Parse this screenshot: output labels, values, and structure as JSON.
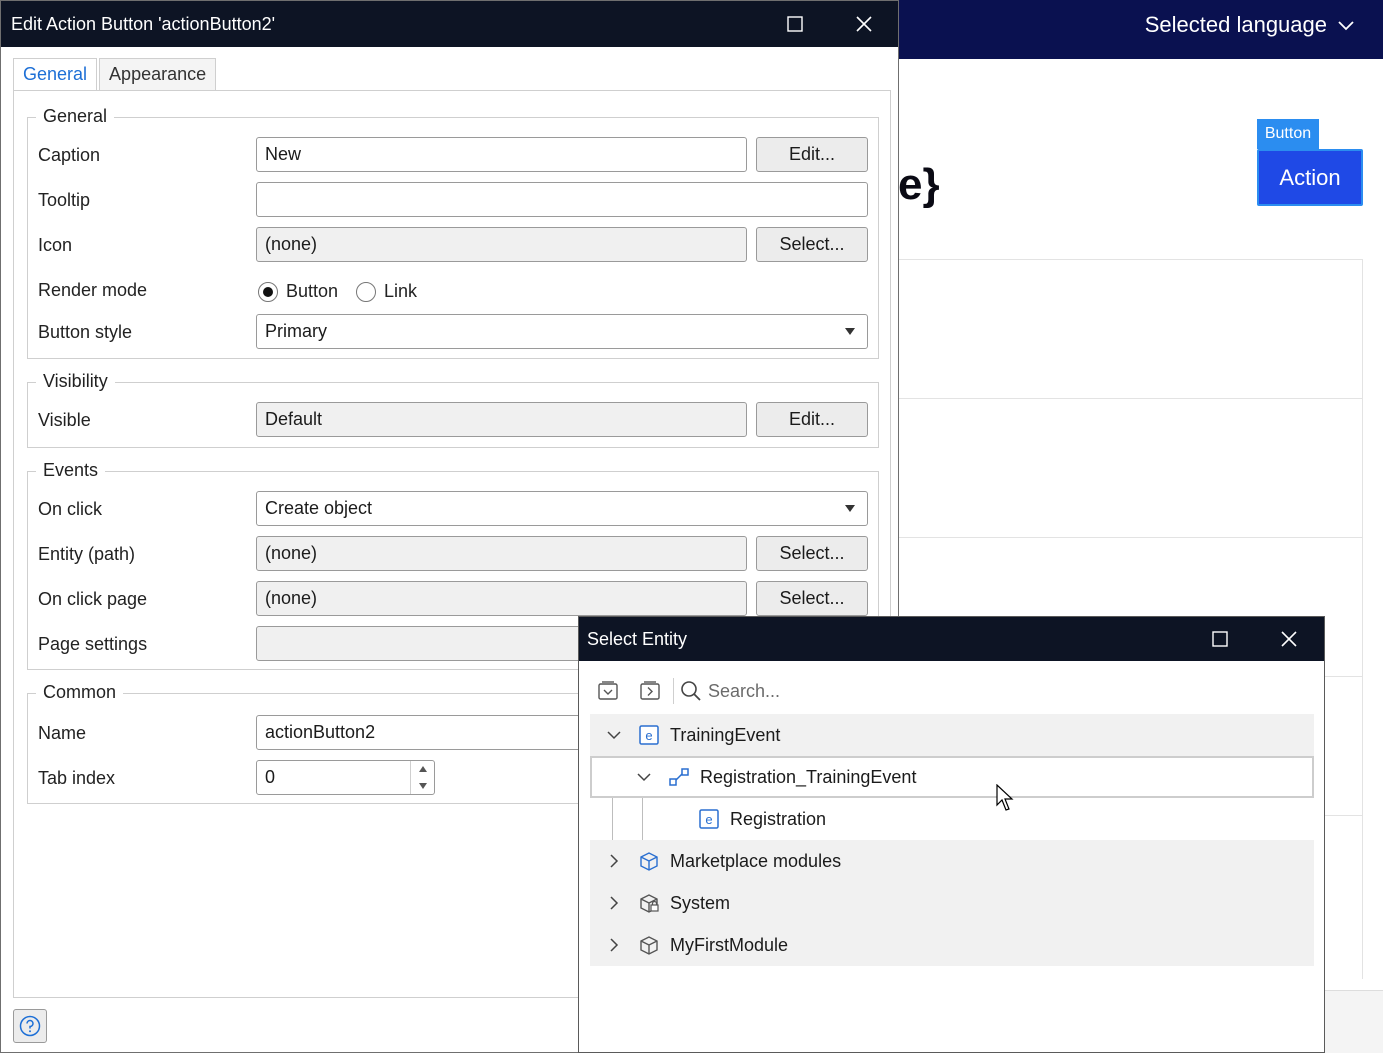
{
  "background": {
    "selected_language": "Selected language",
    "brace_fragment": "e}",
    "button_tag": "Button",
    "action_button": "Action"
  },
  "edit_dialog": {
    "title": "Edit Action Button 'actionButton2'",
    "tabs": [
      {
        "label": "General",
        "active": true
      },
      {
        "label": "Appearance",
        "active": false
      }
    ],
    "general": {
      "legend": "General",
      "caption_label": "Caption",
      "caption_value": "New",
      "caption_button": "Edit...",
      "tooltip_label": "Tooltip",
      "tooltip_value": "",
      "icon_label": "Icon",
      "icon_value": "(none)",
      "icon_button": "Select...",
      "render_mode_label": "Render mode",
      "render_mode_options": [
        "Button",
        "Link"
      ],
      "render_mode_selected": "Button",
      "button_style_label": "Button style",
      "button_style_value": "Primary"
    },
    "visibility": {
      "legend": "Visibility",
      "visible_label": "Visible",
      "visible_value": "Default",
      "visible_button": "Edit..."
    },
    "events": {
      "legend": "Events",
      "on_click_label": "On click",
      "on_click_value": "Create object",
      "entity_label": "Entity (path)",
      "entity_value": "(none)",
      "entity_button": "Select...",
      "on_click_page_label": "On click page",
      "on_click_page_value": "(none)",
      "on_click_page_button": "Select...",
      "page_settings_label": "Page settings"
    },
    "common": {
      "legend": "Common",
      "name_label": "Name",
      "name_value": "actionButton2",
      "tab_index_label": "Tab index",
      "tab_index_value": "0"
    }
  },
  "select_dialog": {
    "title": "Select Entity",
    "search_placeholder": "Search...",
    "tree": [
      {
        "label": "TrainingEvent",
        "expanded": true,
        "icon": "entity-icon"
      },
      {
        "label": "Registration_TrainingEvent",
        "expanded": true,
        "icon": "association-icon"
      },
      {
        "label": "Registration",
        "icon": "entity-icon"
      },
      {
        "label": "Marketplace modules",
        "expanded": false,
        "icon": "module-box-icon"
      },
      {
        "label": "System",
        "expanded": false,
        "icon": "system-module-icon"
      },
      {
        "label": "MyFirstModule",
        "expanded": false,
        "icon": "module-box-icon"
      }
    ]
  },
  "colors": {
    "titlebar": "#0d1424",
    "topbar": "#0a1150",
    "accent": "#1d6fd6",
    "action_button": "#1f49e6"
  }
}
